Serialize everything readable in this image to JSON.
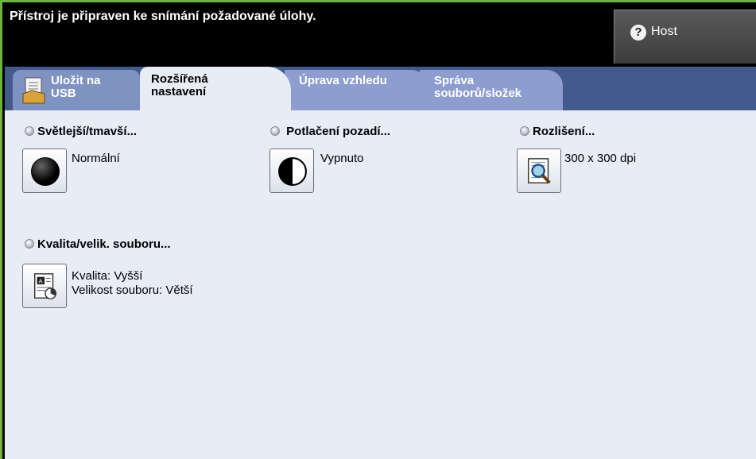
{
  "status": {
    "message": "Přístroj je připraven ke snímání požadované úlohy."
  },
  "host_button": {
    "label": "Host",
    "icon": "help-question-icon"
  },
  "tabs": [
    {
      "label": "Uložit na\nUSB",
      "icon": "usb-save-icon",
      "active": false
    },
    {
      "label": "Rozšířená\nnastavení",
      "active": true
    },
    {
      "label": "Úprava vzhledu",
      "active": false
    },
    {
      "label": "Správa\nsouborů/složek",
      "active": false
    }
  ],
  "options": {
    "lighter_darker": {
      "title": "Světlejší/tmavší...",
      "value": "Normální",
      "icon": "black-circle-icon"
    },
    "background_suppression": {
      "title": "Potlačení pozadí...",
      "value": "Vypnuto",
      "icon": "half-circle-icon"
    },
    "resolution": {
      "title": "Rozlišení...",
      "value": "300 x 300 dpi",
      "icon": "magnifier-document-icon"
    },
    "quality_size": {
      "title": "Kvalita/velik. souboru...",
      "value": "Kvalita: Vyšší\nVelikost souboru: Větší",
      "icon": "document-quality-icon"
    }
  },
  "colors": {
    "frame": "#6bb53a",
    "tab_strip": "#425a8c",
    "tab_inactive": "#8e9dcf",
    "panel": "#e8ecf4"
  }
}
